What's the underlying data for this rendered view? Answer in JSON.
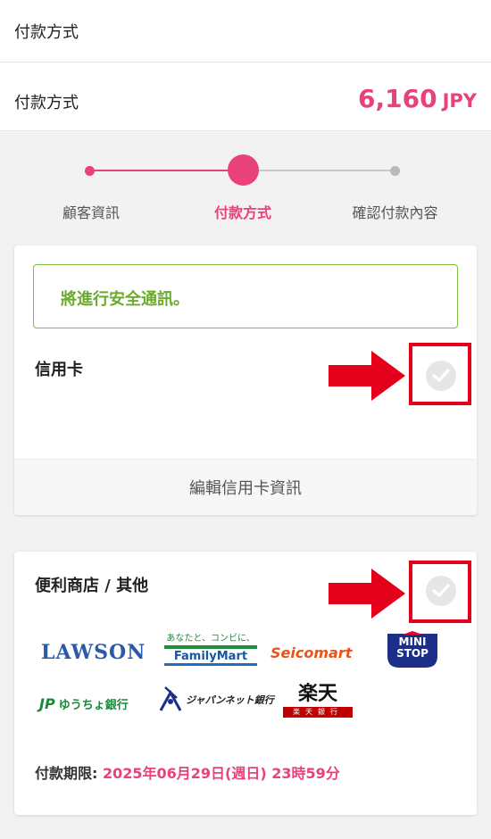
{
  "topbar": {
    "title": "付款方式"
  },
  "summary": {
    "label": "付款方式",
    "amount": "6,160",
    "currency": "JPY"
  },
  "colors": {
    "accent": "#e8417c",
    "secure_green": "#6aaa2c",
    "annotation_red": "#e4001b"
  },
  "stepper": {
    "steps": [
      {
        "label": "顧客資訊",
        "state": "done"
      },
      {
        "label": "付款方式",
        "state": "current"
      },
      {
        "label": "確認付款內容",
        "state": "upcoming"
      }
    ]
  },
  "credit_card": {
    "secure_notice": "將進行安全通訊。",
    "title": "信用卡",
    "selected": false,
    "edit_label": "編輯信用卡資訊"
  },
  "convenience": {
    "title": "便利商店 / 其他",
    "selected": false,
    "logos": {
      "lawson": "LAWSON",
      "familymart_tag": "あなたと、コンビに、",
      "familymart": "FamilyMart",
      "seicomart": "Seicomart",
      "ministop": "MINI STOP",
      "yucho_mark": "JP",
      "yucho": "ゆうちょ銀行",
      "japannet": "ジャパンネット銀行",
      "rakuten": "楽天",
      "rakuten_bank": "楽天銀行"
    },
    "deadline_label": "付款期限: ",
    "deadline_value": "2025年06月29日(週日) 23時59分"
  }
}
